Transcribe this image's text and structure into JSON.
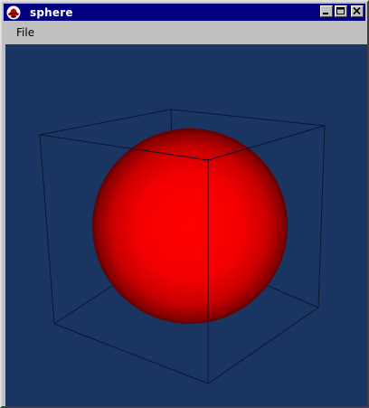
{
  "window": {
    "title": "sphere"
  },
  "menubar": {
    "items": [
      {
        "label": "File"
      }
    ]
  },
  "scene": {
    "background_color": "#1b3563",
    "sphere_color": "#ff0000",
    "wireframe_color": "#0a1530"
  },
  "icons": {
    "app": "redhat-icon",
    "minimize": "minimize-icon",
    "maximize": "maximize-icon",
    "close": "close-icon"
  }
}
